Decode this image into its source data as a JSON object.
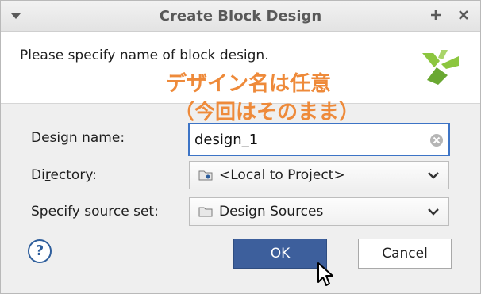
{
  "window": {
    "title": "Create Block Design",
    "menu_icon": "triangle-down-icon",
    "maximize_icon": "plus-icon",
    "close_icon": "close-icon"
  },
  "header": {
    "message": "Please specify name of block design.",
    "logo": "xilinx-logo"
  },
  "annotation": {
    "line1": "デザイン名は任意",
    "line2": "（今回はそのまま）",
    "color": "#ee8a3a"
  },
  "form": {
    "design_name": {
      "label_mnemonic": "D",
      "label_rest": "esign name:",
      "value": "design_1"
    },
    "directory": {
      "label_prefix": "Di",
      "label_mnemonic": "r",
      "label_rest": "ectory:",
      "value": "<Local to Project>"
    },
    "source_set": {
      "label": "Specify source set:",
      "value": "Design Sources"
    }
  },
  "buttons": {
    "help": "?",
    "ok": "OK",
    "cancel": "Cancel"
  },
  "colors": {
    "accent": "#3d74c6",
    "ok_button": "#3d5f9c",
    "annotation": "#ee8a3a"
  }
}
